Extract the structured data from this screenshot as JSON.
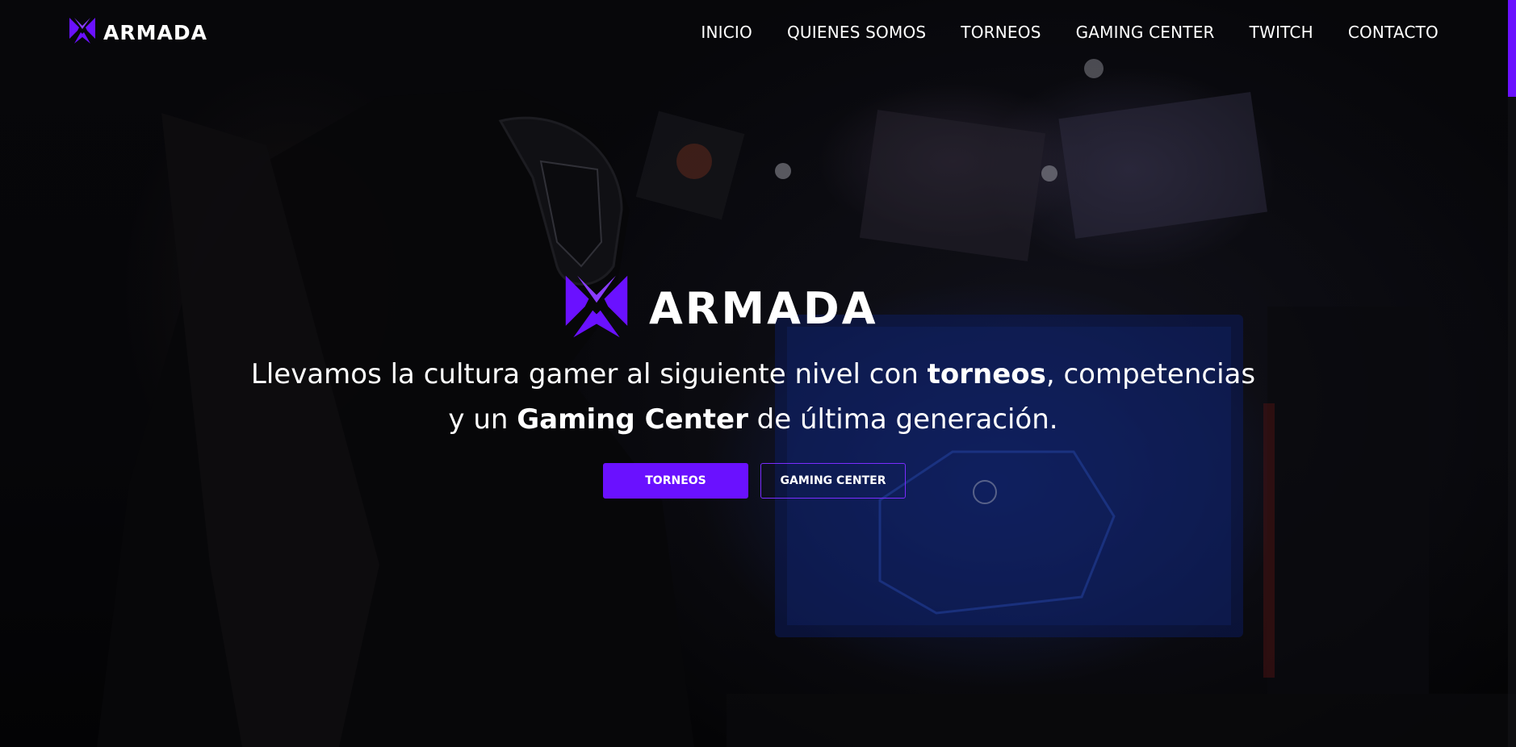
{
  "colors": {
    "accent": "#6a11ff",
    "text": "#ffffff",
    "background": "#050507"
  },
  "nav": {
    "brand": "ARMADA",
    "links": [
      "INICIO",
      "QUIENES SOMOS",
      "TORNEOS",
      "GAMING CENTER",
      "TWITCH",
      "CONTACTO"
    ]
  },
  "hero": {
    "logo_text": "ARMADA",
    "tagline": {
      "part1": "Llevamos la cultura gamer al siguiente nivel con ",
      "bold1": "torneos",
      "part2": ", competencias",
      "part3": "y un ",
      "bold2": "Gaming Center",
      "part4": " de última generación."
    },
    "buttons": {
      "primary": "TORNEOS",
      "secondary": "GAMING CENTER"
    }
  },
  "icons": {
    "logo": "armada-x-logo-icon"
  }
}
